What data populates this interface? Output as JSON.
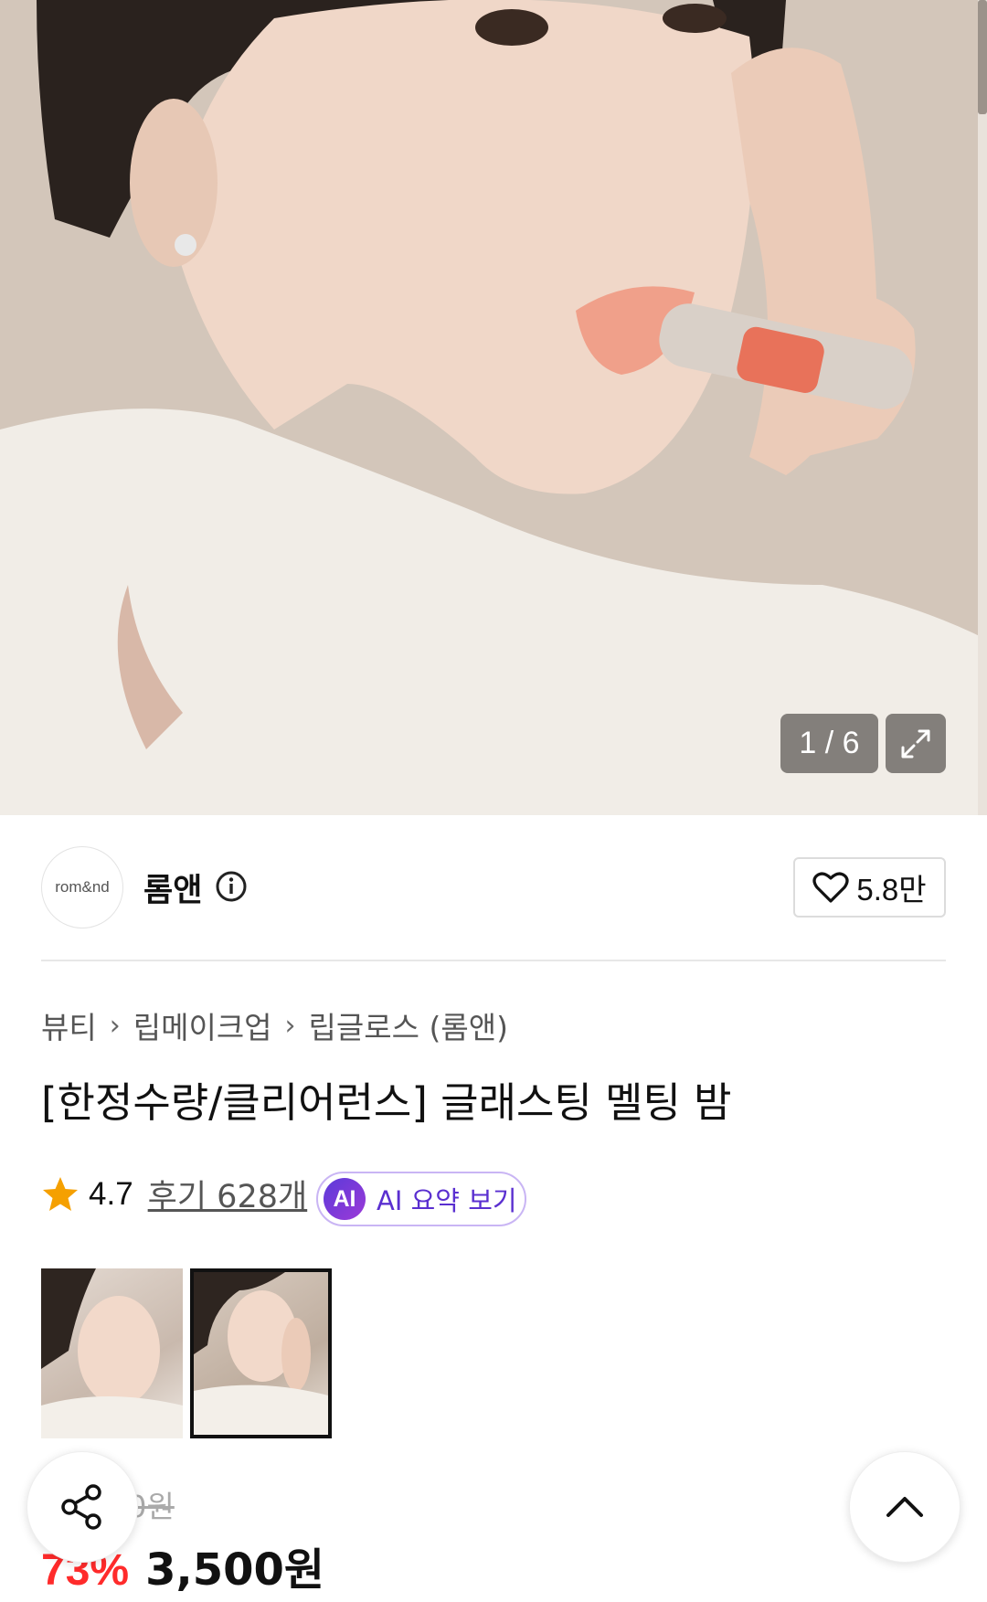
{
  "gallery": {
    "counter": "1 / 6"
  },
  "brand": {
    "logo_text": "rom&nd",
    "name": "롬앤"
  },
  "likes": {
    "count": "5.8만"
  },
  "breadcrumb": [
    "뷰티",
    "립메이크업",
    "립글로스 (롬앤)"
  ],
  "product": {
    "title": "[한정수량/클리어런스] 글래스팅 멜팅 밤",
    "rating": "4.7",
    "reviews": "후기 628개",
    "ai_summary": "AI 요약 보기",
    "ai_badge": "AI",
    "original_price": "13,000원",
    "discount": "73%",
    "price": "3,500원"
  },
  "colors": {
    "accent_red": "#ff2b2b",
    "ai_purple": "#5a2fd0",
    "star": "#f5a000"
  }
}
